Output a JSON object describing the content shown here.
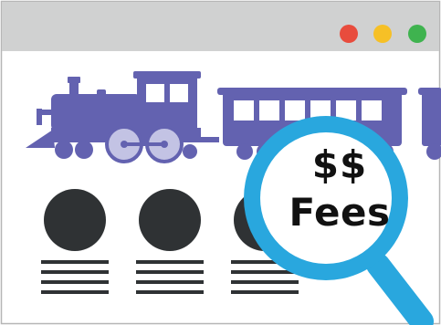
{
  "window": {
    "controls": [
      {
        "name": "close",
        "color": "#e84c3d"
      },
      {
        "name": "minimize",
        "color": "#f6c026"
      },
      {
        "name": "maximize",
        "color": "#3fb34f"
      }
    ],
    "titlebar_color": "#d0d1d1",
    "frame_color": "#b6b6b6"
  },
  "train": {
    "color": "#6362b0",
    "accent": "#c3c3e4",
    "icons": [
      "locomotive-icon",
      "passenger-car-icon"
    ]
  },
  "placeholders": {
    "avatar_color": "#2f3234",
    "count": 3,
    "lines_per_item": 4
  },
  "magnifier": {
    "rim_color": "#29a7de",
    "lens_color": "#ffffff",
    "line1": "$$",
    "line2": "Fees"
  }
}
